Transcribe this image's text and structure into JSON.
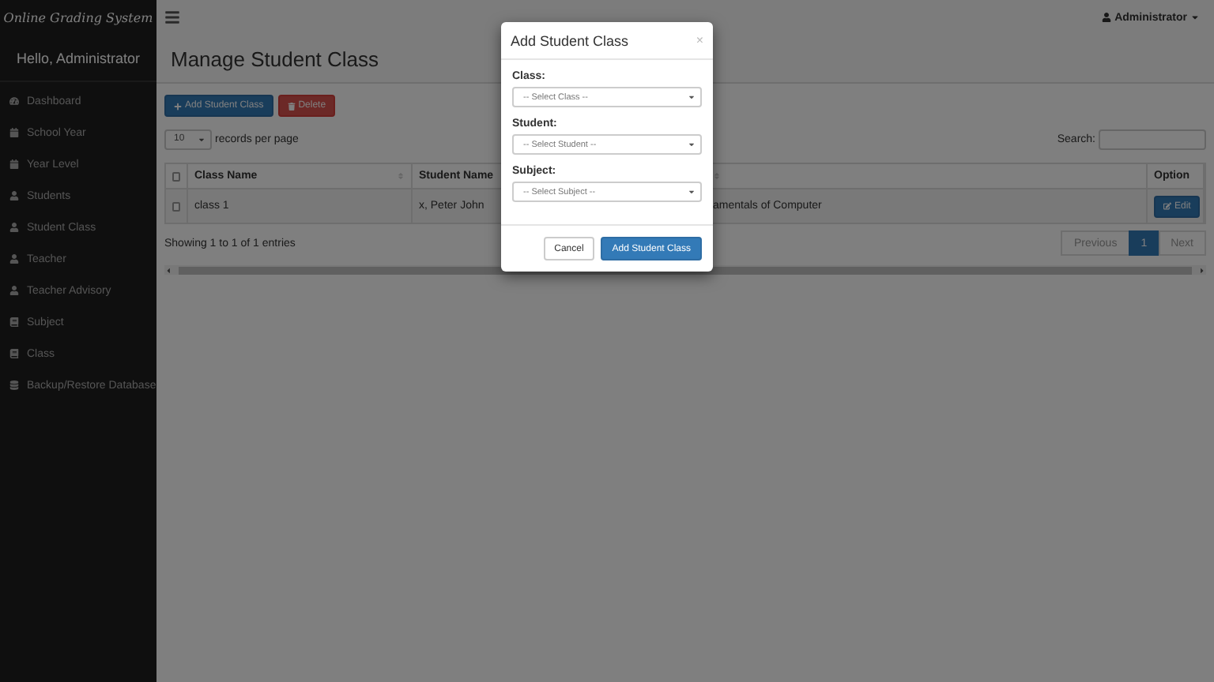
{
  "brand": "Online Grading System",
  "greeting": "Hello, Administrator",
  "sidebar": {
    "items": [
      {
        "label": "Dashboard",
        "kind": "dashboard",
        "selected": false
      },
      {
        "label": "School Year",
        "kind": "calendar",
        "selected": false
      },
      {
        "label": "Year Level",
        "kind": "calendar",
        "selected": false
      },
      {
        "label": "Students",
        "kind": "user",
        "selected": false
      },
      {
        "label": "Student Class",
        "kind": "user",
        "selected": false
      },
      {
        "label": "Teacher",
        "kind": "user",
        "selected": false
      },
      {
        "label": "Teacher Advisory",
        "kind": "user",
        "selected": false
      },
      {
        "label": "Subject",
        "kind": "book",
        "selected": false
      },
      {
        "label": "Class",
        "kind": "book",
        "selected": false
      },
      {
        "label": "Backup/Restore Database",
        "kind": "database",
        "selected": false
      }
    ]
  },
  "user_menu": "Administrator",
  "page_title": "Manage Student Class",
  "actions": [
    {
      "label": "Add Student Class",
      "kind": "primary"
    },
    {
      "label": "Delete",
      "kind": "danger"
    }
  ],
  "page_size": {
    "value": "10",
    "label": "records per page"
  },
  "search": {
    "label": "Search:"
  },
  "table": {
    "select_all": false,
    "columns": [
      "Class Name",
      "Student Name",
      "",
      "Option"
    ],
    "rows": [
      {
        "checked": false,
        "cells": [
          "class 1",
          "x, Peter John",
          "amentals of Computer"
        ],
        "action": "Edit"
      }
    ]
  },
  "info": "Showing 1 to 1 of 1 entries",
  "pagination": [
    {
      "label": "Previous",
      "selected": false,
      "disabled": true
    },
    {
      "label": "1",
      "selected": true,
      "disabled": false
    },
    {
      "label": "Next",
      "selected": false,
      "disabled": true
    }
  ],
  "modal": {
    "title": "Add Student Class",
    "close": "×",
    "fields": [
      {
        "label": "Class:",
        "placeholder": "-- Select Class --"
      },
      {
        "label": "Student:",
        "placeholder": "-- Select Student --"
      },
      {
        "label": "Subject:",
        "placeholder": "-- Select Subject --"
      }
    ],
    "buttons": [
      {
        "label": "Cancel",
        "kind": "default"
      },
      {
        "label": "Add Student Class",
        "kind": "primary"
      }
    ]
  }
}
